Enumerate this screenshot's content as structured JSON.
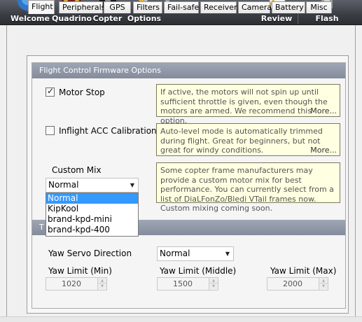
{
  "toolbar": {
    "items": [
      {
        "label": "Welcome",
        "icon": "globe-icon"
      },
      {
        "label": "Quadrino",
        "icon": "board-icon"
      },
      {
        "label": "Copter",
        "icon": "quadcopter-icon"
      },
      {
        "label": "Options",
        "icon": "tools-icon"
      },
      {
        "label": "Review",
        "icon": "document-icon"
      },
      {
        "label": "Flash",
        "icon": "flash-icon"
      }
    ],
    "options_dropdown_icon": "caret-down-icon"
  },
  "tabs": [
    "Flight",
    "Peripherals",
    "GPS",
    "Filters",
    "Fail-safe",
    "Receiver",
    "Camera",
    "Battery",
    "Misc"
  ],
  "active_tab": "Flight",
  "group1": {
    "title": "Flight Control Firmware Options",
    "motor_stop": {
      "label": "Motor Stop",
      "checked": true,
      "info": "If active, the motors will not spin up until sufficient throttle is given, even though the motors are armed. We recommend this option.",
      "more": "More..."
    },
    "inflight_acc": {
      "label": "Inflight ACC Calibration",
      "checked": false,
      "info": "Auto-level mode is automatically trimmed during flight. Great for beginners, but not great for windy conditions.",
      "more": "More..."
    },
    "custom_mix": {
      "label": "Custom Mix",
      "selected": "Normal",
      "info": "Some copter frame manufacturers may provide a custom motor mix for best performance. You can currently select from a list of DiaLFonZo/Bledi VTail frames now. Custom mixing coming soon.",
      "options": [
        "Normal",
        "KipKool",
        "brand-kpd-mini",
        "brand-kpd-400"
      ]
    }
  },
  "group2": {
    "title": "T",
    "yaw_servo_direction": {
      "label": "Yaw Servo Direction",
      "value": "Normal"
    },
    "yaw_limit_min": {
      "label": "Yaw Limit (Min)",
      "value": "1020"
    },
    "yaw_limit_middle": {
      "label": "Yaw Limit (Middle)",
      "value": "1500"
    },
    "yaw_limit_max": {
      "label": "Yaw Limit (Max)",
      "value": "2000"
    }
  },
  "colors": {
    "toolbar_bg": "#3b3d44",
    "group_header": "#9099aa",
    "info_bg": "#ffffe1",
    "selection": "#3399ff"
  }
}
